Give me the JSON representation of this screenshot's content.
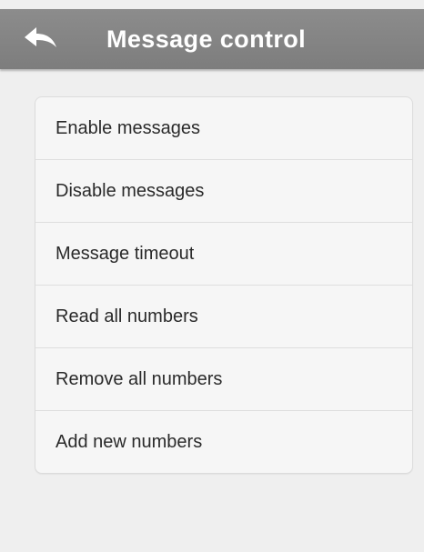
{
  "header": {
    "title": "Message control",
    "back_icon": "back-arrow-icon"
  },
  "menu": {
    "items": [
      {
        "label": "Enable messages"
      },
      {
        "label": "Disable messages"
      },
      {
        "label": "Message timeout"
      },
      {
        "label": "Read all numbers"
      },
      {
        "label": "Remove all numbers"
      },
      {
        "label": "Add new numbers"
      }
    ]
  },
  "colors": {
    "header_bg": "#858585",
    "background": "#efefef",
    "list_bg": "#f6f6f6",
    "text": "#2a2a2a",
    "header_text": "#ffffff"
  }
}
